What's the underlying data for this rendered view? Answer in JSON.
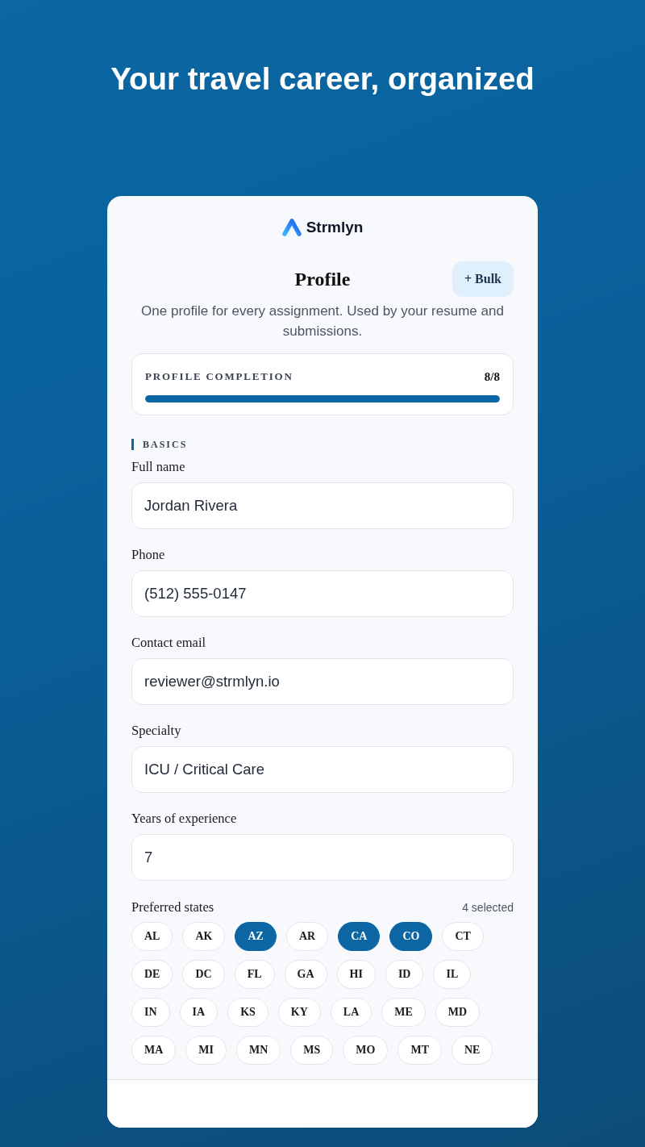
{
  "header": {
    "title": "Your travel career, organized"
  },
  "card": {
    "brand": "Strmlyn",
    "title": "Profile",
    "bulk_button": "+ Bulk",
    "subtitle": "One profile for every assignment. Used by your resume and submissions.",
    "completion": {
      "label": "PROFILE COMPLETION",
      "count": "8/8",
      "level": 1
    },
    "section": {
      "title": "BASICS",
      "fields": [
        {
          "label": "Full name",
          "value": "Jordan Rivera"
        },
        {
          "label": "Phone",
          "value": "(512) 555-0147"
        },
        {
          "label": "Contact email",
          "value": "reviewer@strmlyn.io"
        },
        {
          "label": "Specialty",
          "value": "ICU / Critical Care"
        },
        {
          "label": "Years of experience",
          "value": "7"
        }
      ]
    },
    "states": {
      "label": "Preferred states",
      "count": "4 selected",
      "items": [
        {
          "label": "AL",
          "selected": false
        },
        {
          "label": "AK",
          "selected": false
        },
        {
          "label": "AZ",
          "selected": true
        },
        {
          "label": "AR",
          "selected": false
        },
        {
          "label": "CA",
          "selected": true
        },
        {
          "label": "CO",
          "selected": true
        },
        {
          "label": "CT",
          "selected": false
        },
        {
          "label": "DE",
          "selected": false
        },
        {
          "label": "DC",
          "selected": false
        },
        {
          "label": "FL",
          "selected": false
        },
        {
          "label": "GA",
          "selected": false
        },
        {
          "label": "HI",
          "selected": false
        },
        {
          "label": "ID",
          "selected": false
        },
        {
          "label": "IL",
          "selected": false
        },
        {
          "label": "IN",
          "selected": false
        },
        {
          "label": "IA",
          "selected": false
        },
        {
          "label": "KS",
          "selected": false
        },
        {
          "label": "KY",
          "selected": false
        },
        {
          "label": "LA",
          "selected": false
        },
        {
          "label": "ME",
          "selected": false
        },
        {
          "label": "MD",
          "selected": false
        },
        {
          "label": "MA",
          "selected": false
        },
        {
          "label": "MI",
          "selected": false
        },
        {
          "label": "MN",
          "selected": false
        },
        {
          "label": "MS",
          "selected": false
        },
        {
          "label": "MO",
          "selected": false
        },
        {
          "label": "MT",
          "selected": false
        },
        {
          "label": "NE",
          "selected": false
        }
      ]
    }
  }
}
